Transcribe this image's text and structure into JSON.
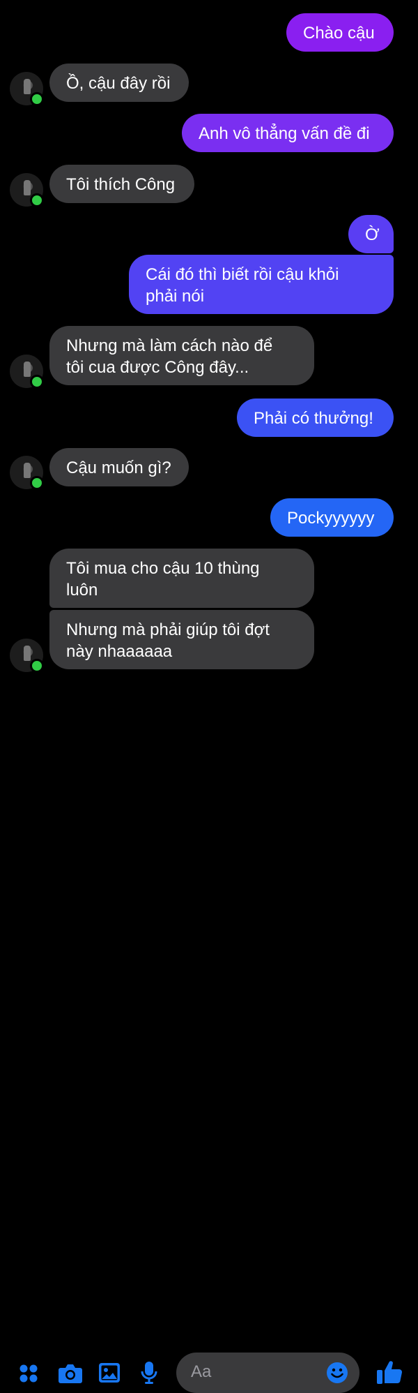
{
  "colors": {
    "accent": "#1877f2",
    "bubble_incoming": "#3a3a3c",
    "online": "#31cc46"
  },
  "messages": [
    {
      "dir": "out",
      "text": "Chào cậu"
    },
    {
      "dir": "in",
      "text": "Ồ, cậu đây rồi"
    },
    {
      "dir": "out",
      "text": "Anh vô thẳng vấn đề đi"
    },
    {
      "dir": "in",
      "text": "Tôi thích Công"
    },
    {
      "dir": "out",
      "text": "Ờ"
    },
    {
      "dir": "out",
      "lines": [
        "Cái đó thì biết rồi cậu khỏi",
        "phải nói"
      ]
    },
    {
      "dir": "in",
      "lines": [
        "Nhưng mà làm cách nào để",
        "tôi cua được Công đây..."
      ]
    },
    {
      "dir": "out",
      "text": "Phải có thưởng!"
    },
    {
      "dir": "in",
      "text": "Cậu muốn gì?"
    },
    {
      "dir": "out",
      "text": "Pockyyyyyy"
    },
    {
      "dir": "in",
      "lines": [
        "Tôi mua cho cậu 10 thùng",
        "luôn"
      ]
    },
    {
      "dir": "in",
      "lines": [
        "Nhưng mà phải giúp tôi đợt",
        "này nhaaaaaa"
      ]
    }
  ],
  "composer": {
    "placeholder": "Aa",
    "icons": [
      "apps-icon",
      "camera-icon",
      "gallery-icon",
      "microphone-icon",
      "emoji-icon",
      "like-icon"
    ]
  }
}
